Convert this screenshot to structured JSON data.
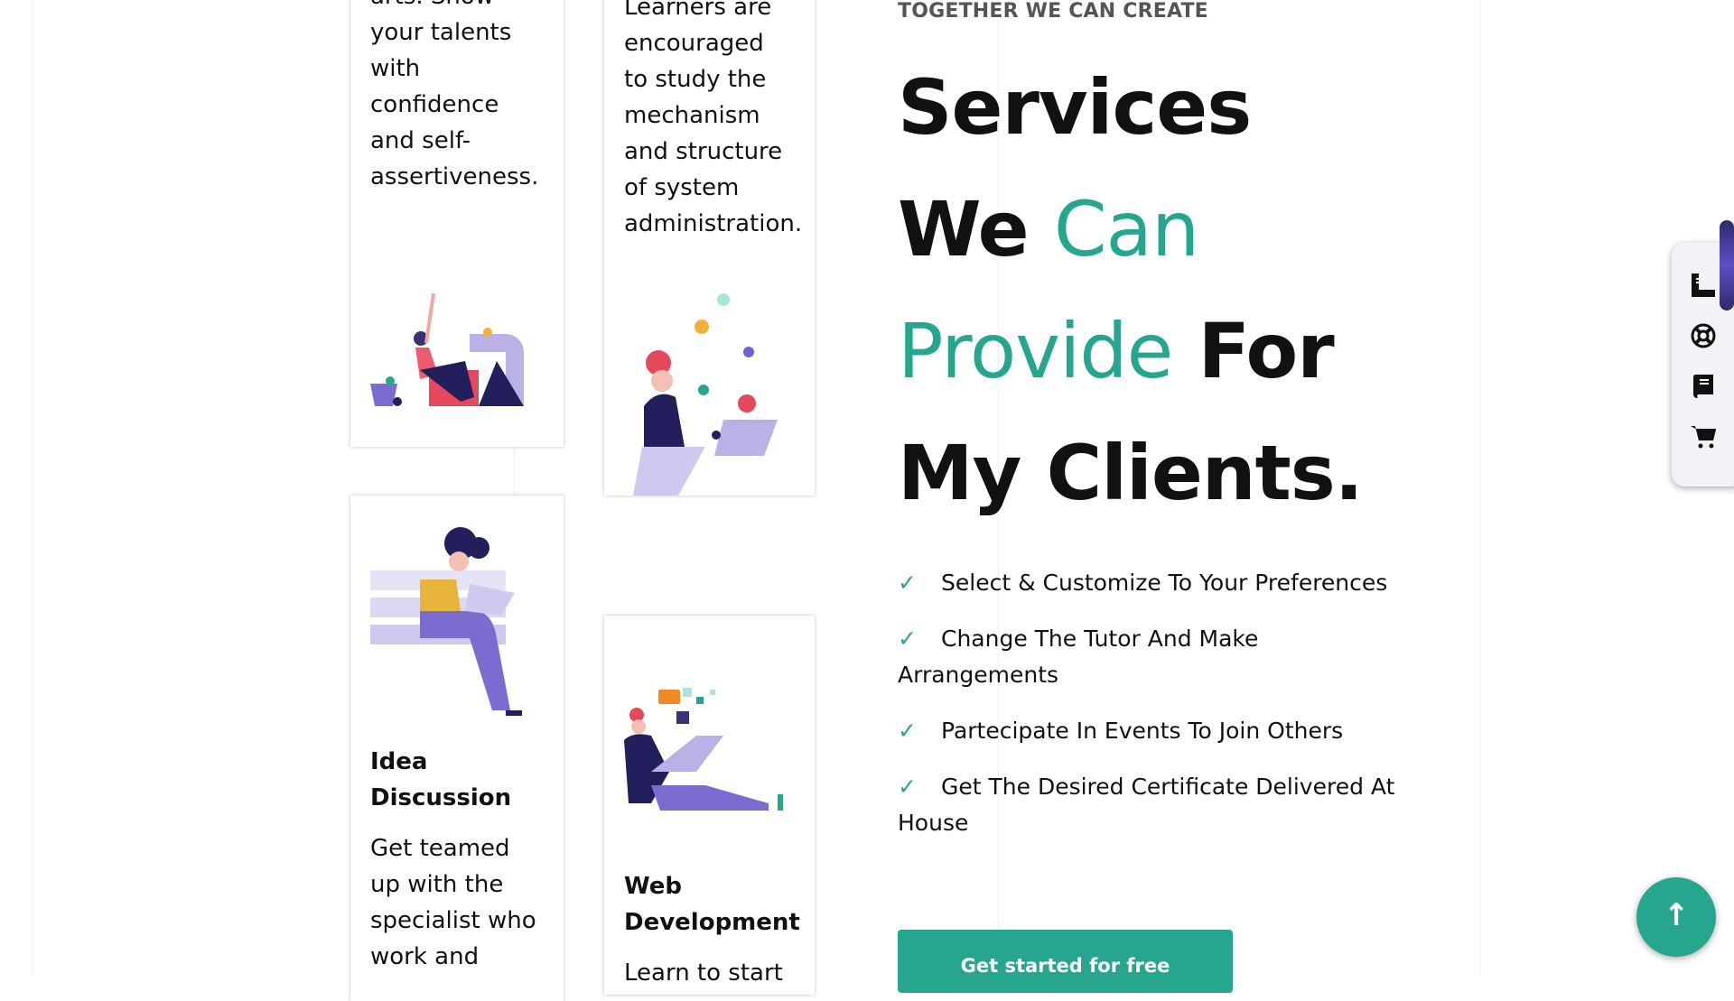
{
  "cards": [
    {
      "text_lines": [
        "arts. Show",
        "your talents",
        "with",
        "confidence",
        "and self-",
        "assertiveness."
      ]
    },
    {
      "text_lines": [
        "Learners are",
        "encouraged",
        "to study the",
        "mechanism",
        "and structure",
        "of system",
        "administration."
      ]
    },
    {
      "title_lines": [
        "Idea",
        "Discussion"
      ],
      "text_lines": [
        "Get teamed",
        "up with the",
        "specialist who",
        "work and"
      ]
    },
    {
      "title_lines": [
        "Web",
        "Development"
      ],
      "text_lines": [
        "Learn to start"
      ]
    }
  ],
  "section": {
    "eyebrow": "TOGETHER WE CAN CREATE",
    "heading": {
      "l1": "Services",
      "l2a": "We",
      "l2b": "Can",
      "l3a": "Provide",
      "l3b": "For",
      "l4": "My Clients."
    },
    "checklist": [
      "Select & Customize To Your Preferences",
      "Change The Tutor And Make Arrangements",
      "Partecipate In Events To Join Others",
      "Get The Desired Certificate Delivered At House"
    ],
    "check_icon": "✓",
    "cta_label": "Get started for free"
  },
  "side_panel": {
    "icons": [
      "ruler-icon",
      "lifebuoy-icon",
      "book-icon",
      "cart-icon"
    ]
  },
  "scroll_top_icon": "↑",
  "colors": {
    "accent": "#27a68f",
    "scrollbar": "#5b4fc4"
  }
}
